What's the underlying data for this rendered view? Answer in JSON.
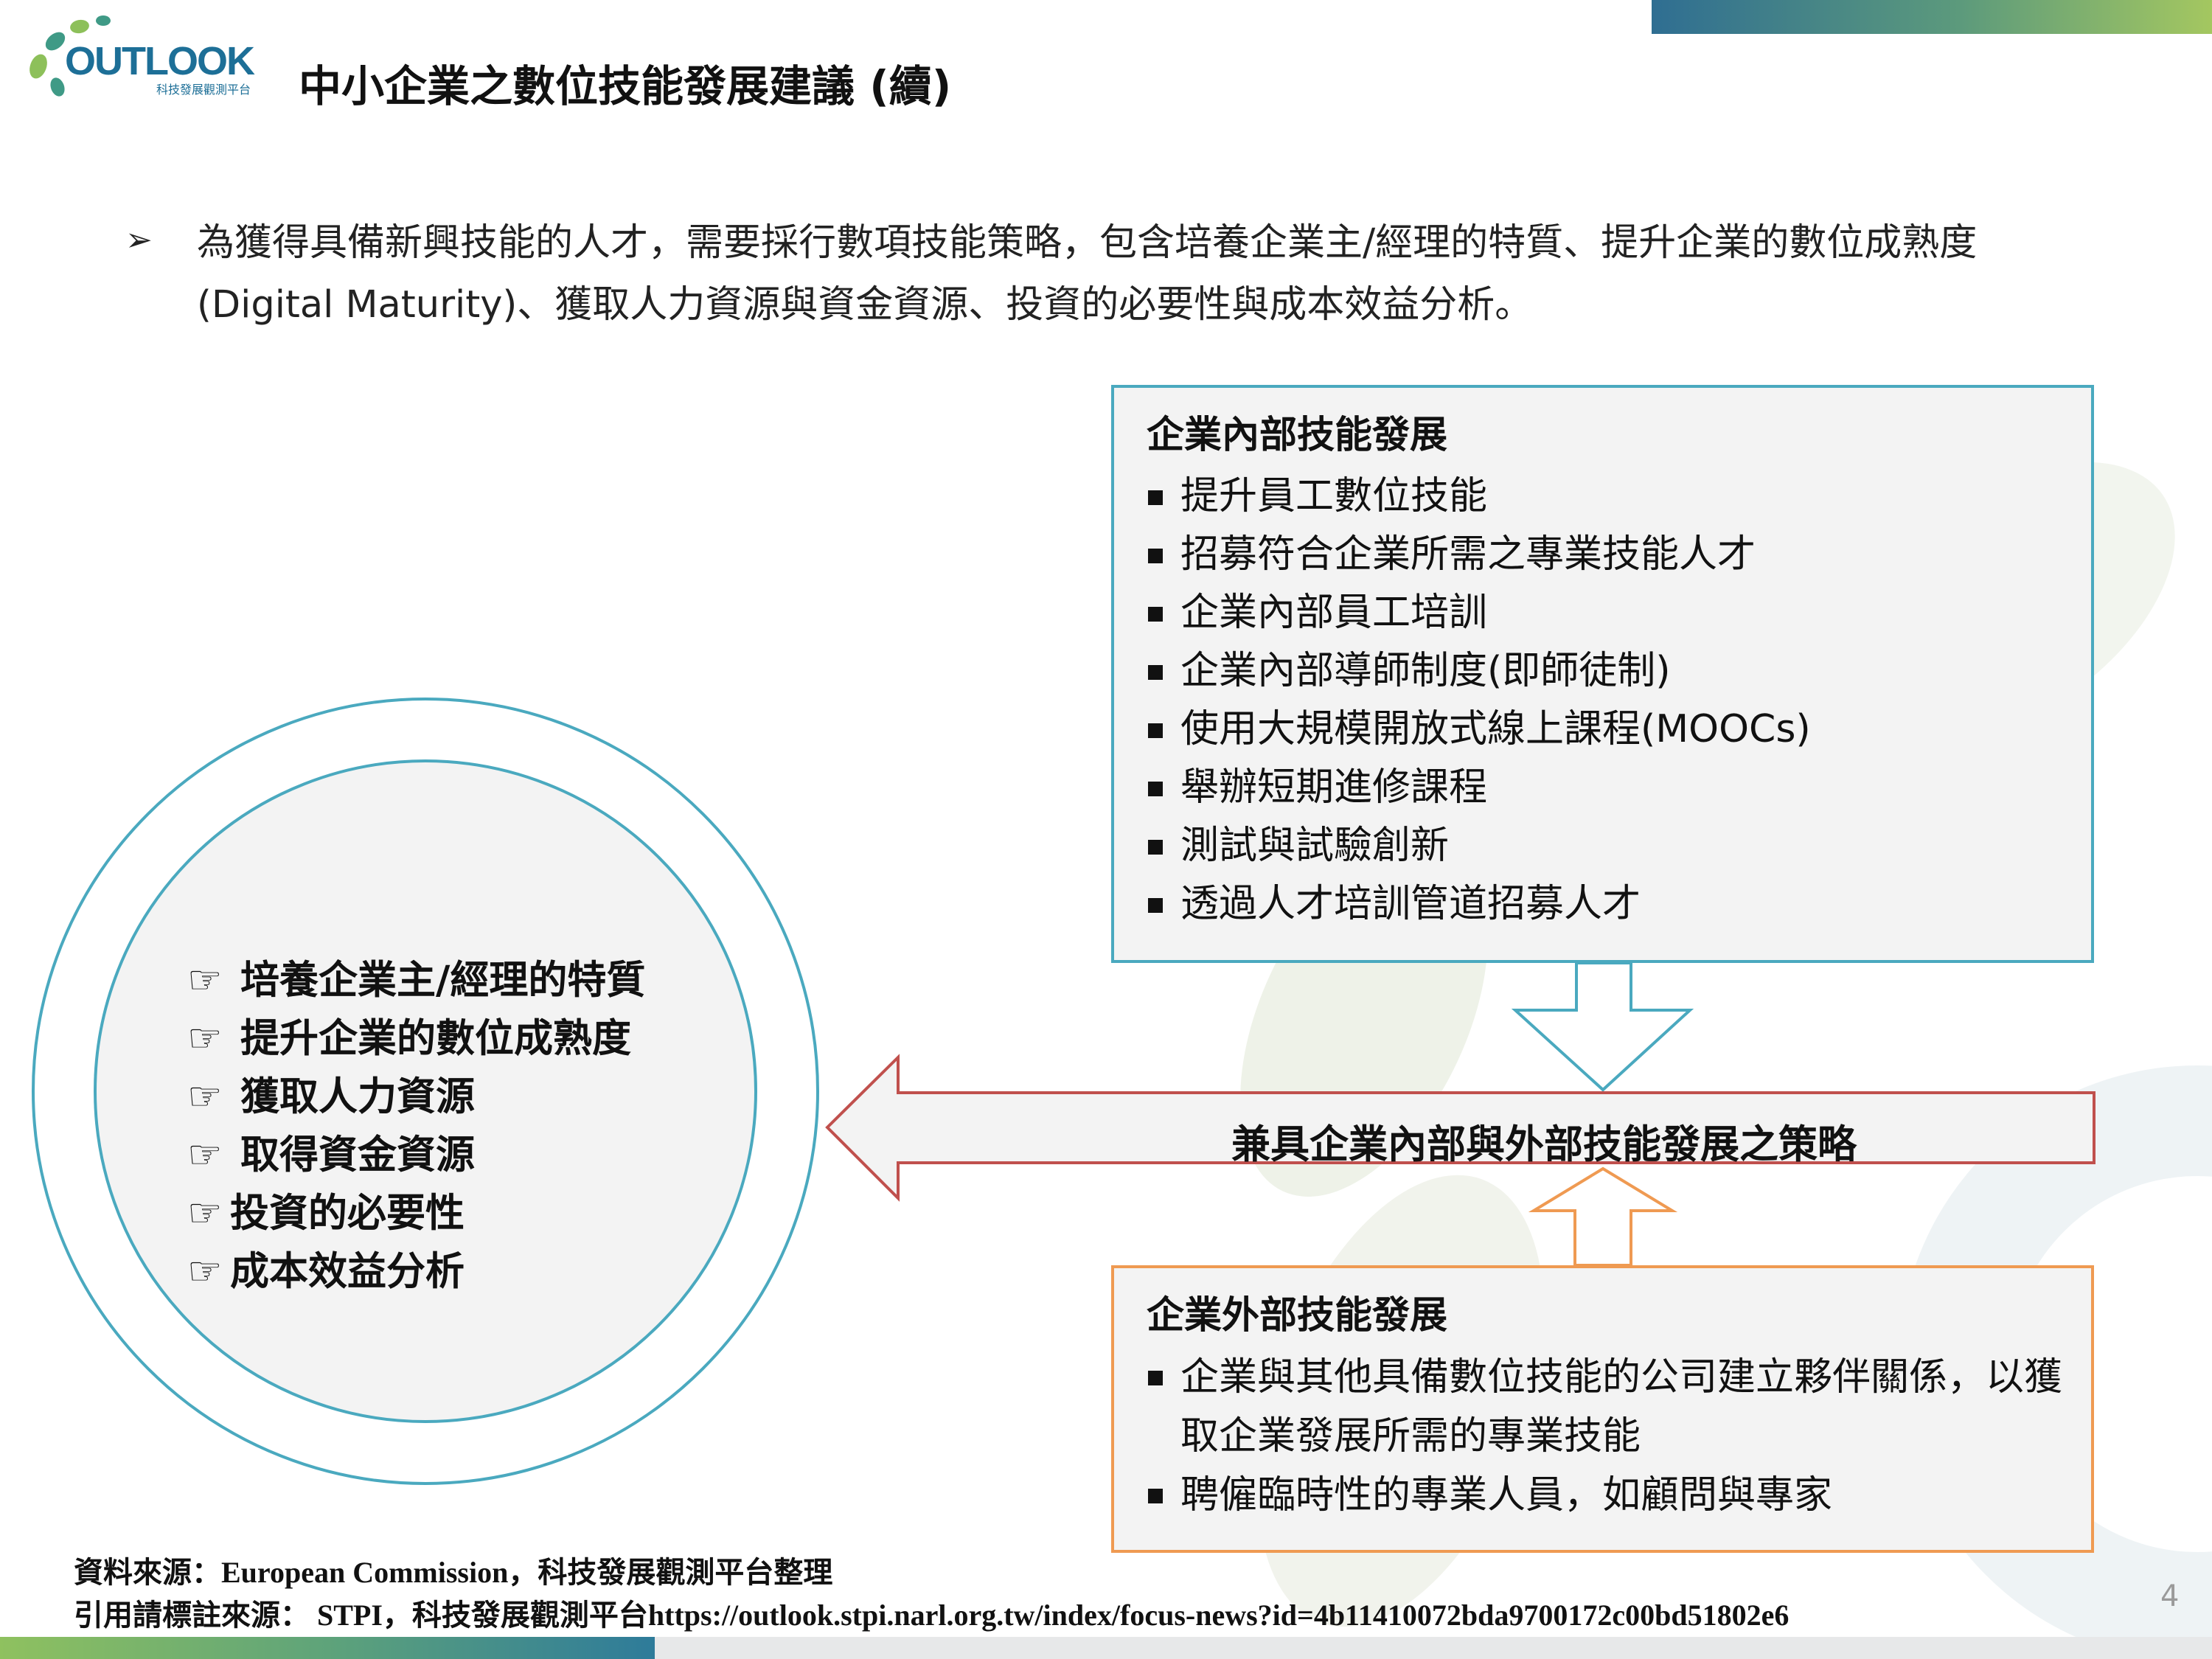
{
  "header": {
    "logo_text": "OUTLOOK",
    "logo_subtitle": "科技發展觀測平台",
    "title": "中小企業之數位技能發展建議 (續)"
  },
  "intro": {
    "bullet_glyph": "➢",
    "text": "為獲得具備新興技能的人才，需要採行數項技能策略，包含培養企業主/經理的特質、提升企業的數位成熟度 (Digital Maturity)、獲取人力資源與資金資源、投資的必要性與成本效益分析。"
  },
  "diagram": {
    "internal": {
      "heading": "企業內部技能發展",
      "items": [
        "提升員工數位技能",
        "招募符合企業所需之專業技能人才",
        "企業內部員工培訓",
        "企業內部導師制度(即師徒制)",
        "使用大規模開放式線上課程(MOOCs)",
        "舉辦短期進修課程",
        "測試與試驗創新",
        "透過人才培訓管道招募人才"
      ]
    },
    "external": {
      "heading": "企業外部技能發展",
      "items": [
        "企業與其他具備數位技能的公司建立夥伴關係，以獲取企業發展所需的專業技能",
        "聘僱臨時性的專業人員，如顧問與專家"
      ]
    },
    "strategy_label": "兼具企業內部與外部技能發展之策略",
    "circle": {
      "hand_glyph": "☞",
      "items": [
        "培養企業主/經理的特質",
        "提升企業的數位成熟度",
        "獲取人力資源",
        "取得資金資源",
        "投資的必要性",
        "成本效益分析"
      ]
    },
    "colors": {
      "internal_border": "#4aa9bf",
      "external_border": "#ef9a52",
      "strategy_border": "#c0504d",
      "circle_border": "#4aa9bf"
    }
  },
  "footer": {
    "source": "資料來源：European Commission，科技發展觀測平台整理",
    "citation": "引用請標註來源： STPI，科技發展觀測平台https://outlook.stpi.narl.org.tw/index/focus-news?id=4b11410072bda9700172c00bd51802e6",
    "page_number": "4"
  }
}
